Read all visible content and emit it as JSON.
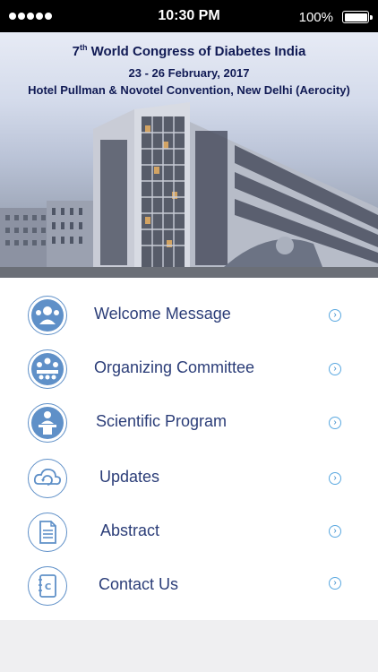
{
  "status_bar": {
    "time": "10:30 PM",
    "battery": "100%",
    "signal_bars": 5
  },
  "hero": {
    "title_ordinal": "7",
    "title_ordinal_suffix": "th",
    "title_rest": " World Congress of Diabetes India",
    "dates": "23 - 26 February, 2017",
    "venue": "Hotel Pullman & Novotel Convention, New Delhi (Aerocity)"
  },
  "menu": {
    "items": [
      {
        "label": "Welcome Message",
        "icon": "user-group-icon"
      },
      {
        "label": "Organizing Committee",
        "icon": "committee-icon"
      },
      {
        "label": "Scientific Program",
        "icon": "speaker-podium-icon"
      },
      {
        "label": "Updates",
        "icon": "cloud-sync-icon"
      },
      {
        "label": "Abstract",
        "icon": "document-icon"
      },
      {
        "label": "Contact Us",
        "icon": "contact-book-icon"
      }
    ]
  },
  "colors": {
    "title_text": "#101a54",
    "menu_text": "#2b3d78",
    "icon_blue": "#5f90c8",
    "chevron_blue": "#2f85c9",
    "background": "#efeff1"
  }
}
